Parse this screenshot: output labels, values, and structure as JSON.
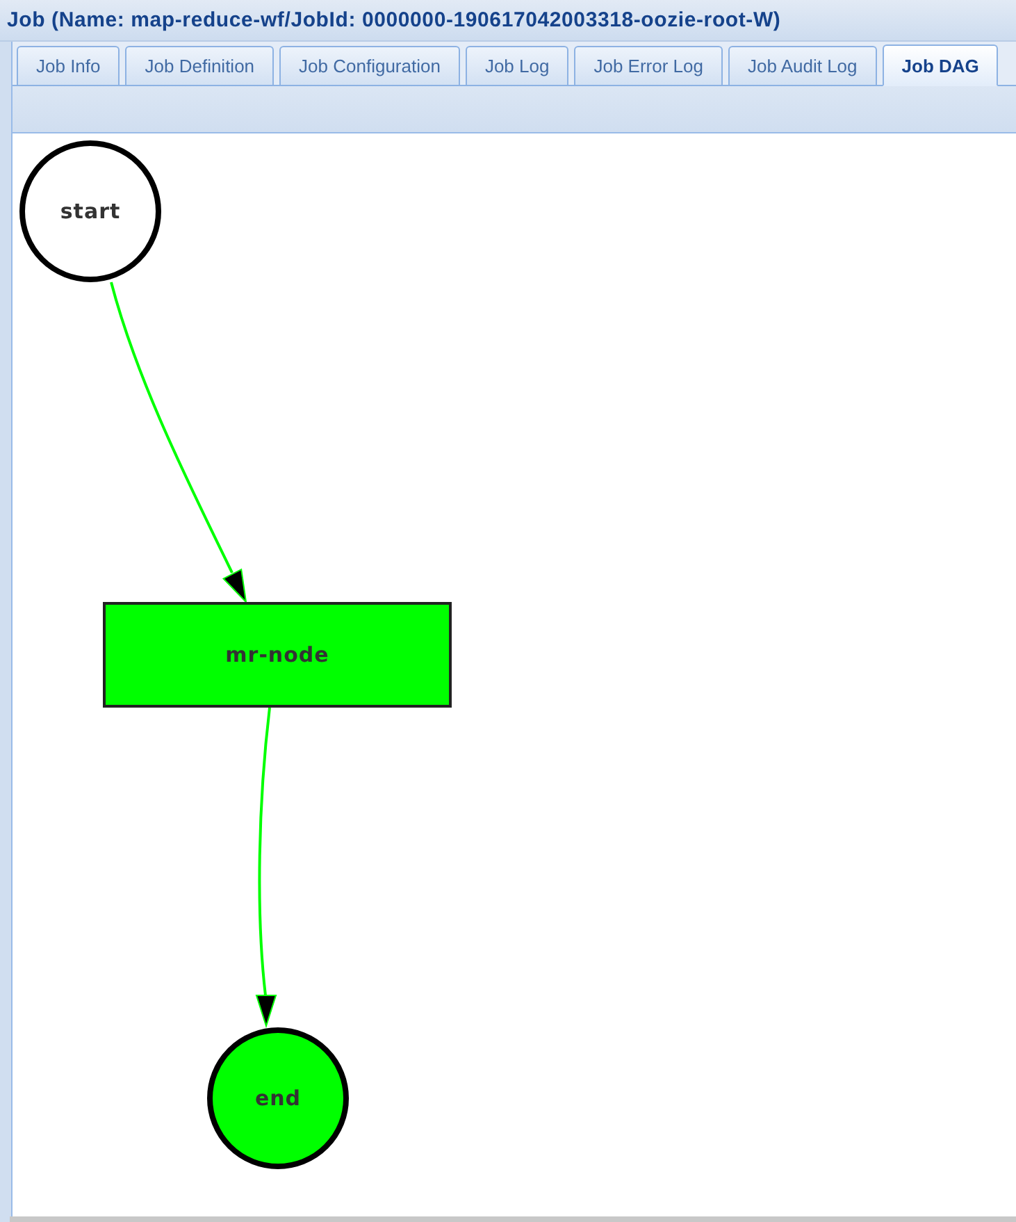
{
  "window": {
    "title": "Job (Name: map-reduce-wf/JobId: 0000000-190617042003318-oozie-root-W)"
  },
  "tabs": [
    {
      "label": "Job Info",
      "selected": false
    },
    {
      "label": "Job Definition",
      "selected": false
    },
    {
      "label": "Job Configuration",
      "selected": false
    },
    {
      "label": "Job Log",
      "selected": false
    },
    {
      "label": "Job Error Log",
      "selected": false
    },
    {
      "label": "Job Audit Log",
      "selected": false
    },
    {
      "label": "Job DAG",
      "selected": true
    }
  ],
  "dag": {
    "nodes": [
      {
        "label": "start",
        "kind": "circle",
        "color": "#ffffff"
      },
      {
        "label": "mr-node",
        "kind": "box",
        "color": "#00ff00"
      },
      {
        "label": "end",
        "kind": "circle",
        "color": "#00ff00"
      }
    ]
  }
}
